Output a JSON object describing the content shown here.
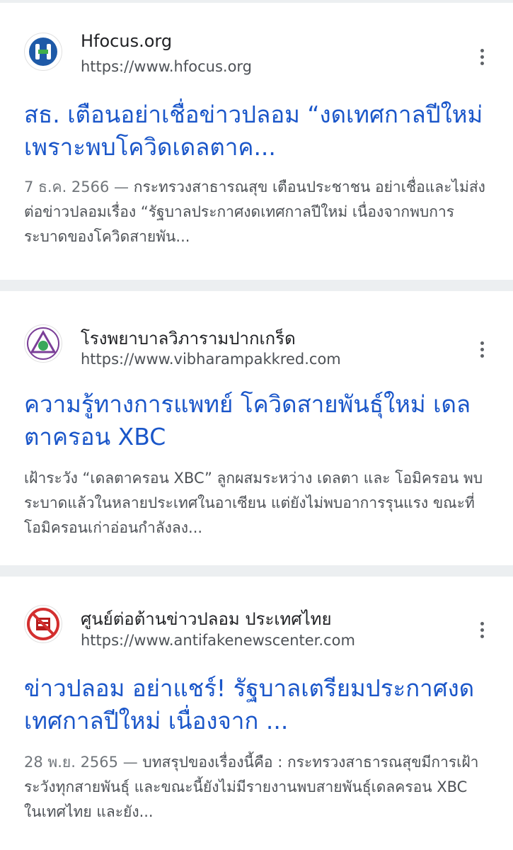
{
  "results": [
    {
      "site_name": "Hfocus.org",
      "url": "https://www.hfocus.org",
      "title": "สธ. เตือนอย่าเชื่อข่าวปลอม “งดเทศกาลปีใหม่เพราะพบโควิดเดลตาค...",
      "date": "7 ธ.ค. 2566 — ",
      "snippet": "กระทรวงสาธารณสุข เตือนประชาชน อย่าเชื่อและไม่ส่งต่อข่าวปลอมเรื่อง “รัฐบาลประกาศงดเทศกาลปีใหม่ เนื่องจากพบการระบาดของโควิดสายพัน...",
      "favicon": "hfocus-logo"
    },
    {
      "site_name": "โรงพยาบาลวิภารามปากเกร็ด",
      "url": "https://www.vibharampakkred.com",
      "title": "ความรู้ทางการแพทย์ โควิดสายพันธุ์ใหม่ เดลตาครอน XBC",
      "date": "",
      "snippet": "เฝ้าระวัง “เดลตาครอน XBC” ลูกผสมระหว่าง เดลตา และ โอมิครอน พบระบาดแล้วในหลายประเทศในอาเซียน แต่ยังไม่พบอาการรุนแรง ขณะที่โอมิครอนเก่าอ่อนกำลังลง...",
      "favicon": "vibharam-logo"
    },
    {
      "site_name": "ศูนย์ต่อต้านข่าวปลอม ประเทศไทย",
      "url": "https://www.antifakenewscenter.com",
      "title": "ข่าวปลอม อย่าแชร์! รัฐบาลเตรียมประกาศงดเทศกาลปีใหม่ เนื่องจาก ...",
      "date": "28 พ.ย. 2565 — ",
      "snippet": "บทสรุปของเรื่องนี้คือ : กระทรวงสาธารณสุขมีการเฝ้าระวังทุกสายพันธุ์ และขณะนี้ยังไม่มีรายงานพบสายพันธุ์เดลครอน XBC ในเทศไทย และยัง...",
      "favicon": "antifakenews-logo"
    }
  ],
  "colors": {
    "link": "#1a56c9",
    "snippet": "#4d5156",
    "divider": "#eceff1"
  }
}
